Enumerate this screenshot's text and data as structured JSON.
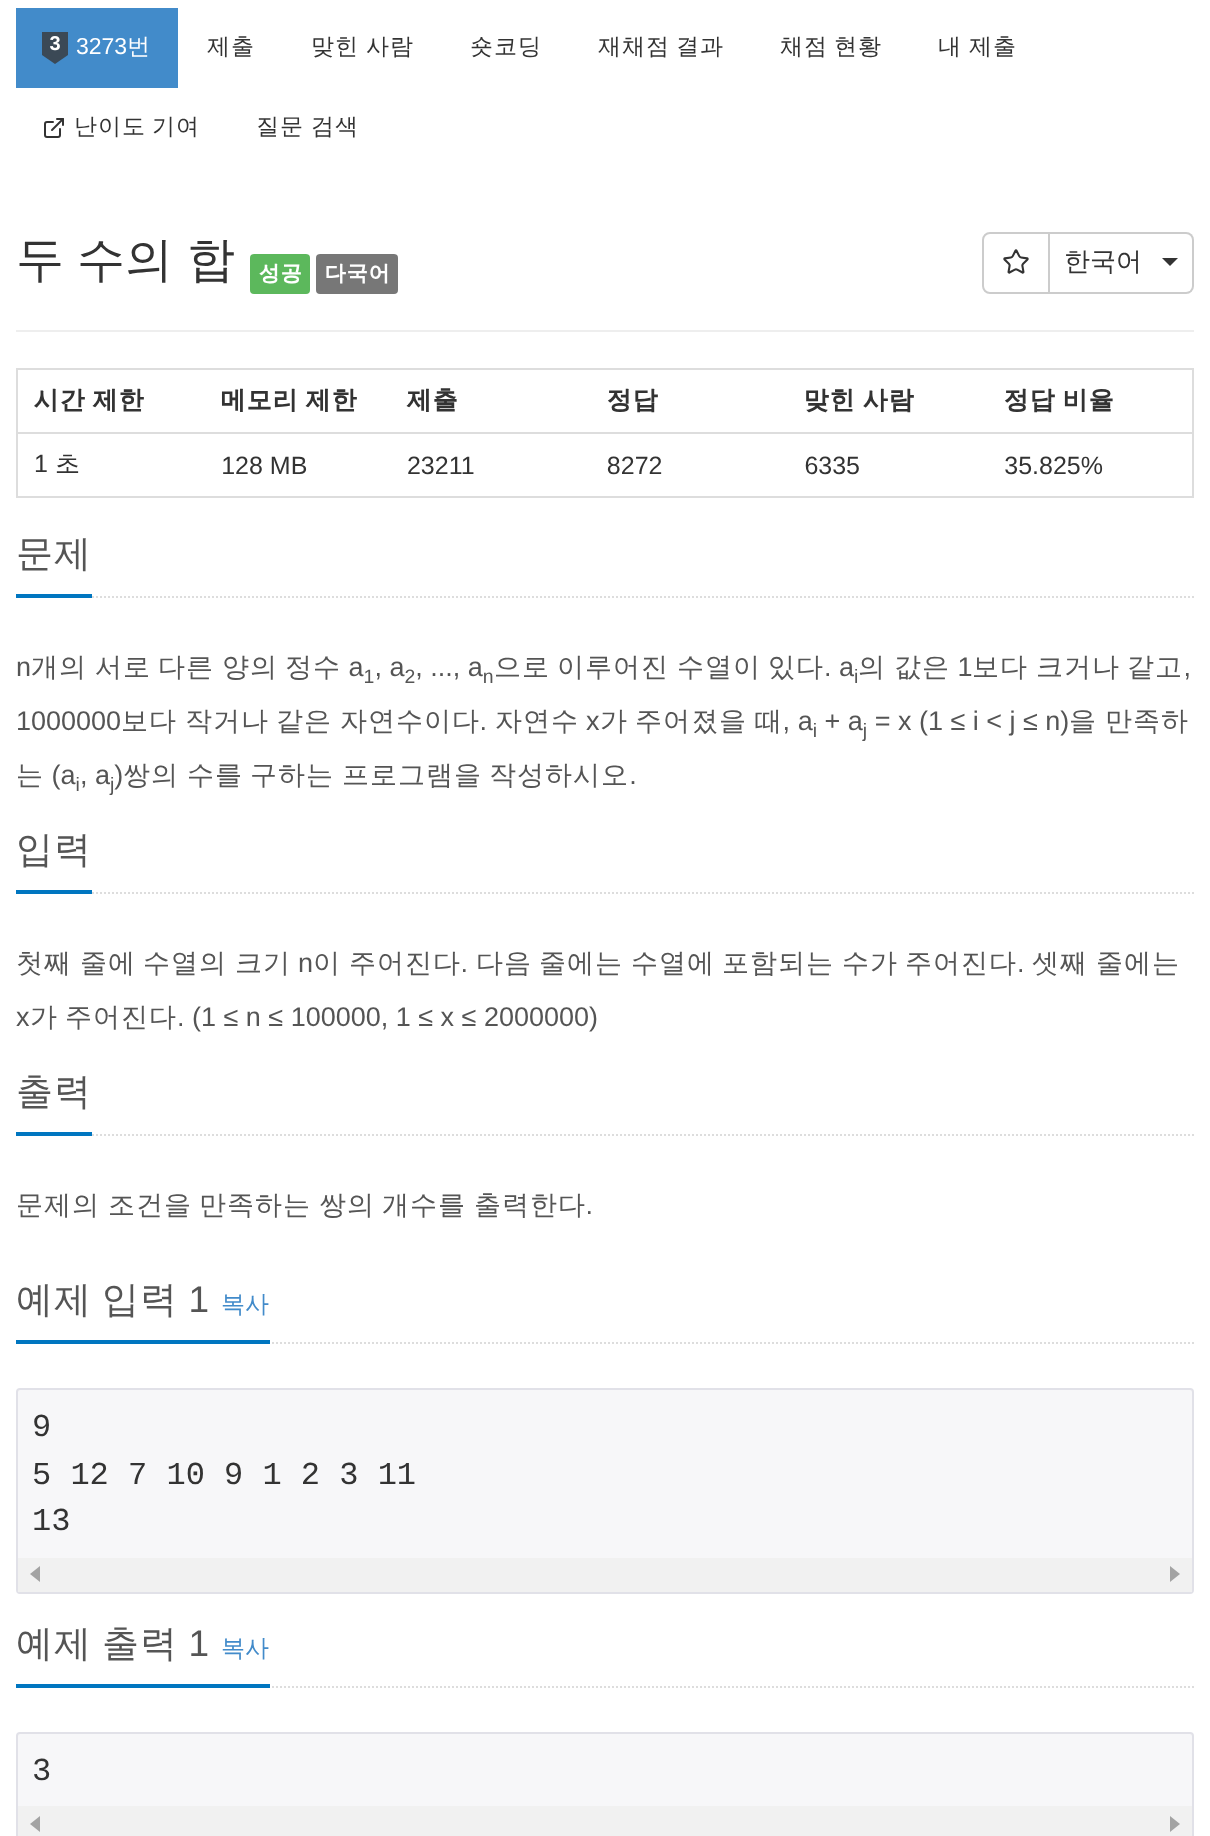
{
  "tabs": [
    {
      "label": "3273번",
      "tier": "3",
      "kind": "tab",
      "selected": true
    },
    {
      "label": "제출",
      "kind": "tab",
      "selected": false
    },
    {
      "label": "맞힌 사람",
      "kind": "tab",
      "selected": false
    },
    {
      "label": "숏코딩",
      "kind": "tab",
      "selected": false
    },
    {
      "label": "재채점 결과",
      "kind": "tab",
      "selected": false
    },
    {
      "label": "채점 현황",
      "kind": "tab",
      "selected": false
    },
    {
      "label": "내 제출",
      "kind": "tab",
      "selected": false
    },
    {
      "label": "난이도 기여",
      "kind": "external",
      "selected": false
    },
    {
      "label": "질문 검색",
      "kind": "tab",
      "selected": false
    }
  ],
  "problem": {
    "title": "두 수의 합",
    "labels": [
      {
        "text": "성공",
        "color": "#5cb85c"
      },
      {
        "text": "다국어",
        "color": "#777777"
      }
    ]
  },
  "favorite": {
    "starred": false
  },
  "language": {
    "value": "한국어"
  },
  "info_table": {
    "columns": [
      "시간 제한",
      "메모리 제한",
      "제출",
      "정답",
      "맞힌 사람",
      "정답 비율"
    ],
    "rows": [
      [
        "1 초",
        "128 MB",
        "23211",
        "8272",
        "6335",
        "35.825%"
      ]
    ]
  },
  "sections": [
    {
      "heading": "문제",
      "text": "n개의 서로 다른 양의 정수 a$_{1}$, a$_{2}$, ..., a$_{n}$으로 이루어진 수열이 있다. a$_{i}$의 값은 1보다 크거나 같고, 1000000보다 작거나 같은 자연수이다. 자연수 x가 주어졌을 때, a$_{i}$ + a$_{j}$ = x (1 ≤ i < j ≤ n)을 만족하는 (a$_{i}$, a$_{j}$)쌍의 수를 구하는 프로그램을 작성하시오."
    },
    {
      "heading": "입력",
      "text": "첫째 줄에 수열의 크기 n이 주어진다. 다음 줄에는 수열에 포함되는 수가 주어진다. 셋째 줄에는 x가 주어진다. (1 ≤ n ≤ 100000, 1 ≤ x ≤ 2000000)"
    },
    {
      "heading": "출력",
      "text": "문제의 조건을 만족하는 쌍의 개수를 출력한다."
    }
  ],
  "samples": [
    {
      "heading": "예제 입력 1",
      "copy": "복사",
      "content": "9\n5 12 7 10 9 1 2 3 11\n13"
    },
    {
      "heading": "예제 출력 1",
      "copy": "복사",
      "content": "3"
    }
  ]
}
